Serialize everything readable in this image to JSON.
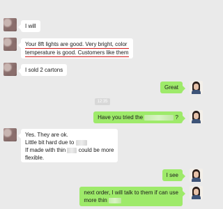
{
  "messages": [
    {
      "side": "in",
      "text": "I will"
    },
    {
      "side": "in",
      "line1": "Your 8ft lights are good. Very bright, color",
      "line2": "temperature is good. Customers like them"
    },
    {
      "side": "in",
      "text": "I sold 2 cartons"
    },
    {
      "side": "out",
      "text": "Great"
    },
    {
      "side": "out",
      "text_before": "Have you tried the",
      "text_after": "?"
    },
    {
      "side": "in",
      "line1": "Yes. They are ok.",
      "line2": "Little bit hard due to",
      "line3_before": "If made with thin",
      "line3_after": "could be more",
      "line4": "flexible."
    },
    {
      "side": "out",
      "text": "I see"
    },
    {
      "side": "out",
      "line1_before": "next order, I will talk to them if can use",
      "line2_before": "more thin"
    }
  ],
  "timestamp": "12:35",
  "colors": {
    "background": "#eaeaea",
    "incoming": "#ffffff",
    "outgoing": "#9eea6a",
    "highlight": "#d11919"
  }
}
